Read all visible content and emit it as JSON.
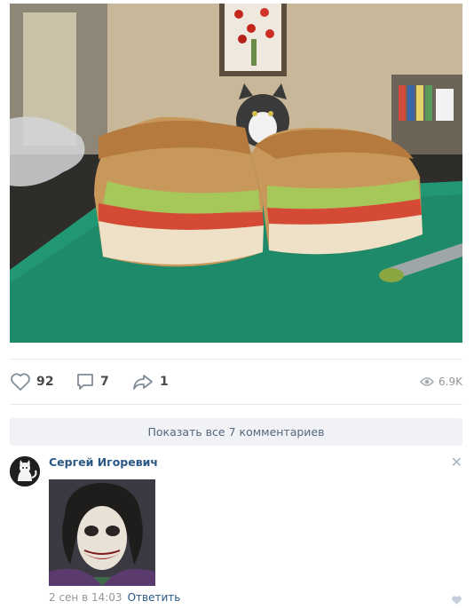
{
  "post": {
    "image_alt": "Two halves of a sandwich on a green cutting board with a cat in the background",
    "likes": "92",
    "comments": "7",
    "shares": "1",
    "views": "6.9K"
  },
  "comments_section": {
    "show_all_label": "Показать все 7 комментариев",
    "items": [
      {
        "author": "Сергей Игоревич",
        "date": "2 сен в 14:03",
        "reply_label": "Ответить"
      }
    ]
  },
  "icons": {
    "like": "heart-icon",
    "comment": "comment-icon",
    "share": "share-arrow-icon",
    "views": "eye-icon",
    "close": "close-icon"
  },
  "colors": {
    "link": "#2a5885",
    "muted": "#939699",
    "icon": "#818c99",
    "button_bg": "#f0f2f5"
  }
}
